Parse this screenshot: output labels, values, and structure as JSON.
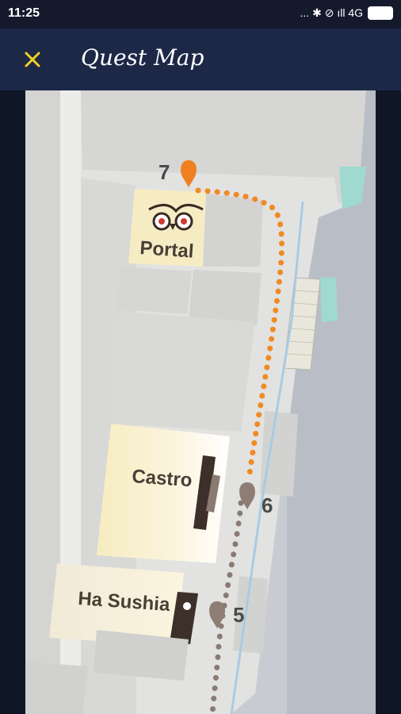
{
  "status_bar": {
    "time": "11:25",
    "indicators": "... ✱ ⊘ ıll 4G",
    "icons": [
      "more-dots-icon",
      "bluetooth-icon",
      "alarm-off-icon",
      "signal-icon",
      "network-4g",
      "battery-icon"
    ]
  },
  "app_bar": {
    "close_icon": "close-icon",
    "title": "Quest Map"
  },
  "map": {
    "stores": {
      "portal": "Portal",
      "castro": "Castro",
      "ha_sushia": "Ha Sushia"
    },
    "pins": {
      "p7": "7",
      "p6": "6",
      "p5": "5"
    },
    "colors": {
      "active_route": "#f08a24",
      "inactive_route": "#8a7b72",
      "active_pin": "#ef8020",
      "inactive_pin": "#8d7d74",
      "floor": "#d9d9d8",
      "accent_teal": "#9fd9cf",
      "highlight": "#f8edc4"
    },
    "brand_logo_icon": "owl-eyes-logo-icon"
  }
}
